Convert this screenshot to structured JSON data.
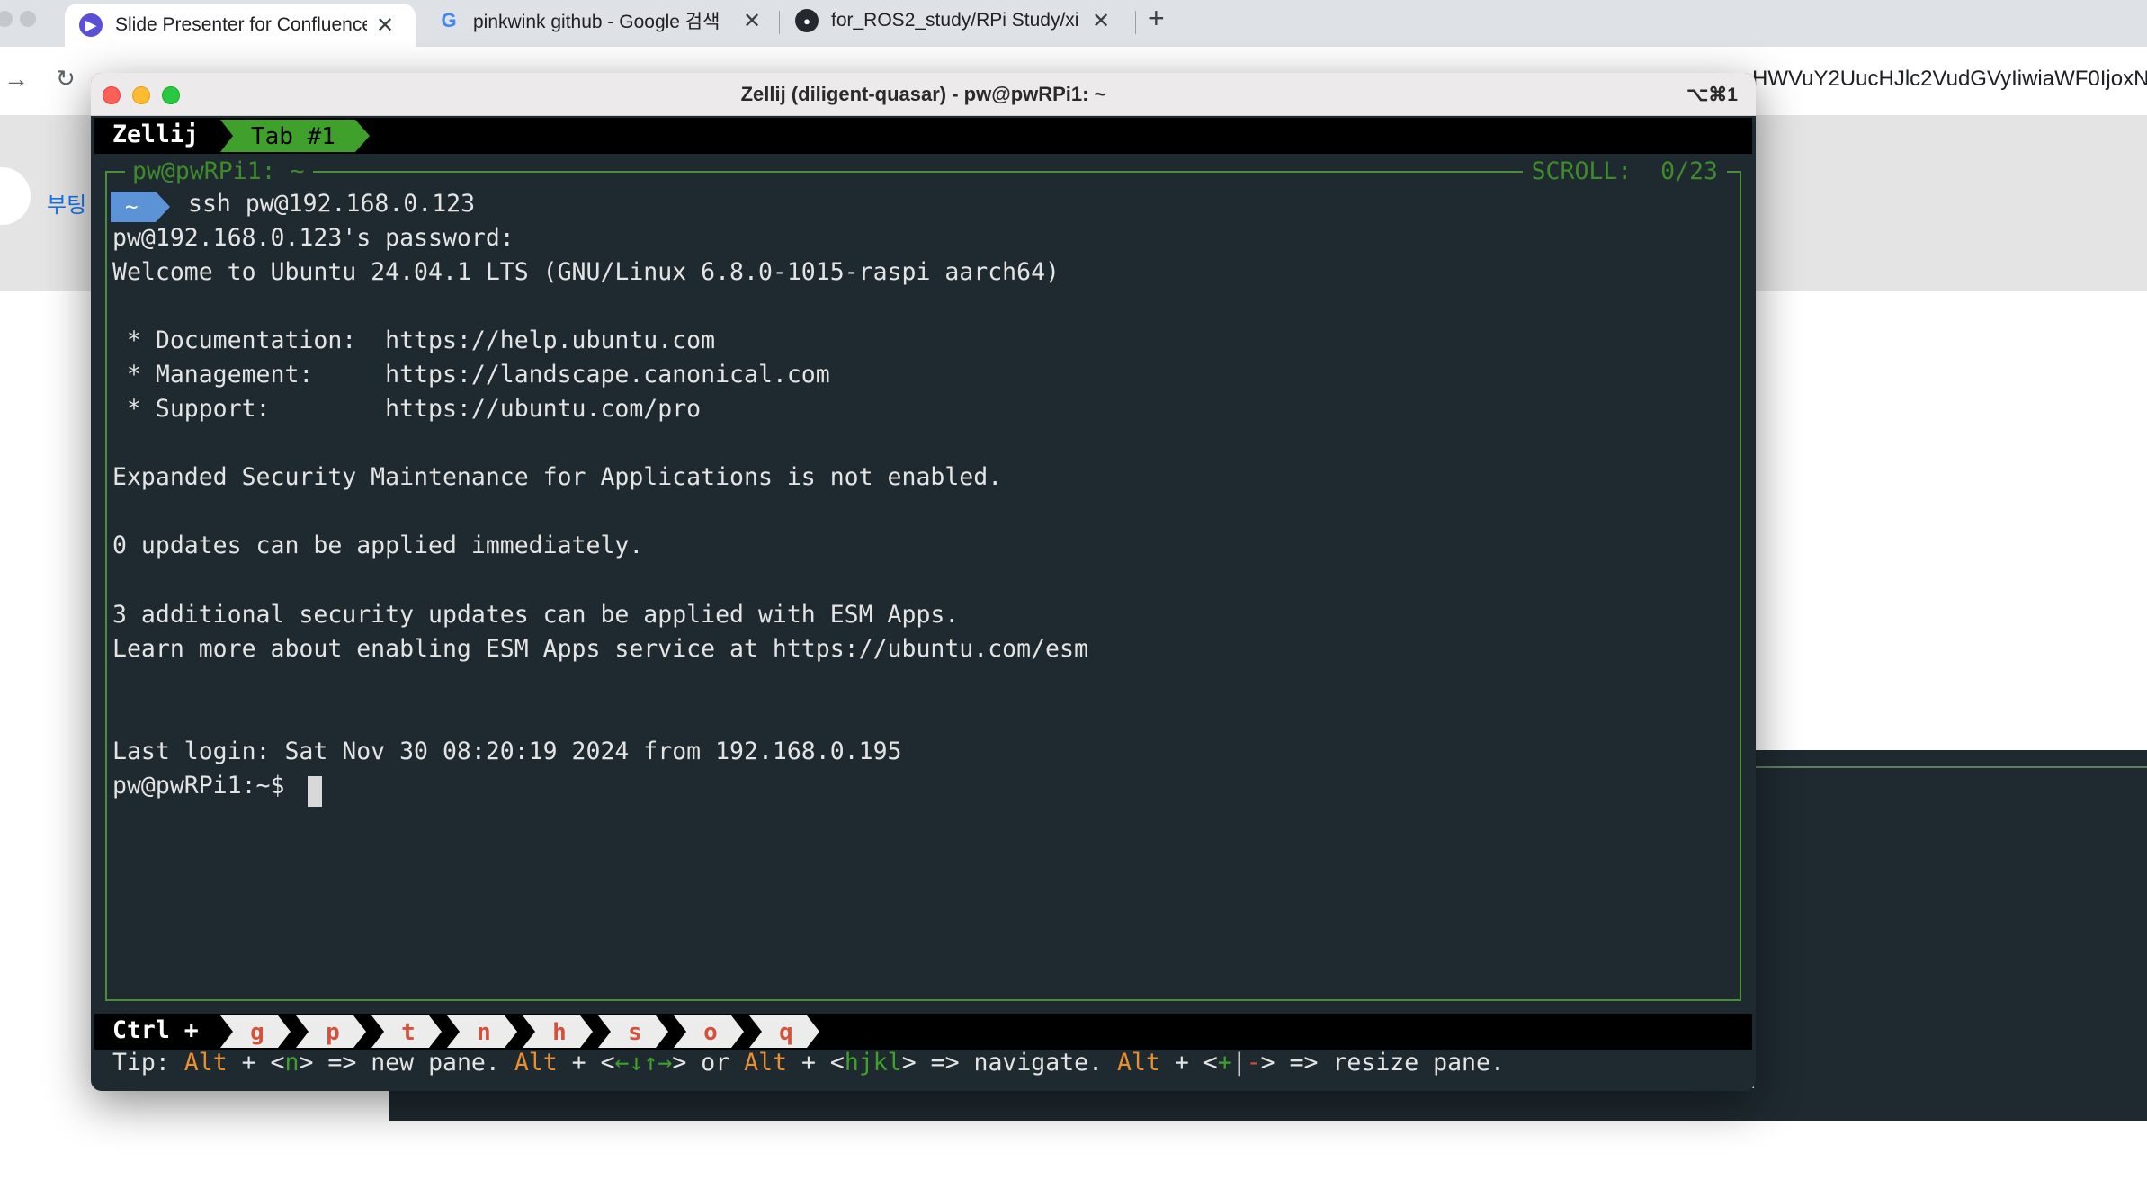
{
  "browser": {
    "tabs": [
      {
        "title": "Slide Presenter for Confluence",
        "favicon": "slide-presenter-icon",
        "active": true
      },
      {
        "title": "pinkwink github - Google 검색",
        "favicon": "google-icon",
        "active": false
      },
      {
        "title": "for_ROS2_study/RPi Study/xi",
        "favicon": "github-icon",
        "active": false
      }
    ],
    "tab_close_glyph": "✕",
    "new_tab_glyph": "+",
    "url_tail": "HWVuY2UucHJlc2VudGVyIiwiaWF0IjoxN",
    "sidebar_partial_text": "부팅"
  },
  "terminal": {
    "window_title": "Zellij (diligent-quasar) - pw@pwRPi1: ~",
    "window_shortcut": "⌥⌘1",
    "zellij": {
      "name": "Zellij",
      "tab_label": "Tab #1",
      "pane_title": "pw@pwRPi1: ~",
      "scroll_label": "SCROLL:  0/23"
    },
    "prompt_arrow_label": "~",
    "lines": [
      "ssh pw@192.168.0.123",
      "pw@192.168.0.123's password:",
      "Welcome to Ubuntu 24.04.1 LTS (GNU/Linux 6.8.0-1015-raspi aarch64)",
      "",
      " * Documentation:  https://help.ubuntu.com",
      " * Management:     https://landscape.canonical.com",
      " * Support:        https://ubuntu.com/pro",
      "",
      "Expanded Security Maintenance for Applications is not enabled.",
      "",
      "0 updates can be applied immediately.",
      "",
      "3 additional security updates can be applied with ESM Apps.",
      "Learn more about enabling ESM Apps service at https://ubuntu.com/esm",
      "",
      "",
      "Last login: Sat Nov 30 08:20:19 2024 from 192.168.0.195",
      "pw@pwRPi1:~$"
    ],
    "status_bar": {
      "ctrl_label": "Ctrl +",
      "keys": [
        "g",
        "p",
        "t",
        "n",
        "h",
        "s",
        "o",
        "q"
      ]
    },
    "tip": {
      "prefix": "Tip: ",
      "alt": "Alt",
      "plus": " + ",
      "n_open": "<",
      "n_key": "n",
      "n_close": ">",
      "new_pane": " => new pane. ",
      "arrows_open": "<",
      "arrows": "←↓↑→",
      "arrows_close": ">",
      "or": " or ",
      "hjkl_open": "<",
      "hjkl": "hjkl",
      "hjkl_close": ">",
      "navigate": " => navigate. ",
      "resize_open": "<",
      "resize_plus": "+",
      "resize_bar": "|",
      "resize_minus": "-",
      "resize_close": ">",
      "resize": " => resize pane."
    }
  },
  "colors": {
    "terminal_bg": "#1e2a30",
    "zellij_green": "#3fa12c",
    "pane_border": "#4b8d3a",
    "prompt_blue": "#5b93d6",
    "tip_orange": "#e8902f",
    "tl_red": "#fe5f57",
    "tl_yellow": "#febb2e",
    "tl_green": "#28c840"
  }
}
